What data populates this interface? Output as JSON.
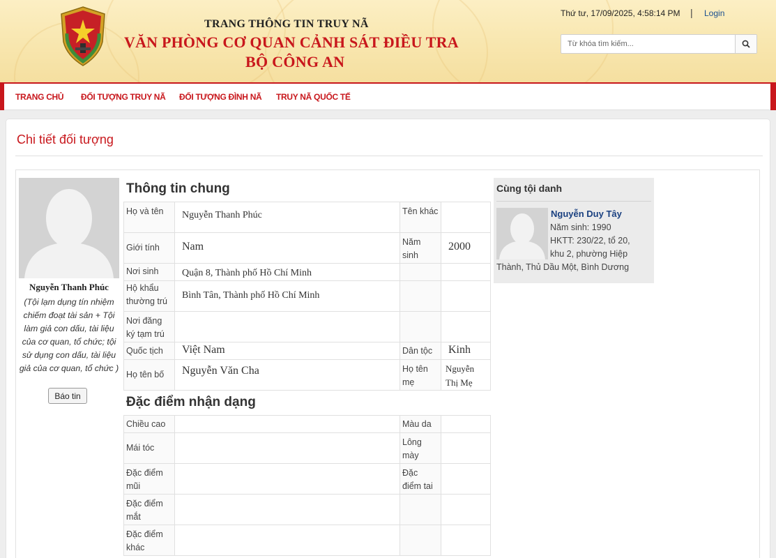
{
  "header": {
    "title_small": "TRANG THÔNG TIN TRUY NÃ",
    "title_main": "VĂN PHÒNG CƠ QUAN CẢNH SÁT ĐIỀU TRA",
    "title_sub": "BỘ CÔNG AN",
    "datetime": "Thứ tư, 17/09/2025, 4:58:14 PM",
    "separator": "|",
    "login_label": "Login",
    "search_placeholder": "Từ khóa tìm kiếm...",
    "search_icon": "search-icon",
    "emblem_icon": "police-emblem-icon"
  },
  "nav": {
    "items": [
      "TRANG CHỦ",
      "ĐỐI TƯỢNG TRUY NÃ",
      "ĐỐI TƯỢNG ĐÌNH NÃ",
      "TRUY NÃ QUỐC TẾ"
    ]
  },
  "page": {
    "title": "Chi tiết đối tượng"
  },
  "profile": {
    "name": "Nguyễn Thanh Phúc",
    "crime": "(Tội lạm dụng tín nhiệm chiếm đoạt tài sản + Tội làm giả con dấu, tài liệu của cơ quan, tổ chức; tội sử dụng con dấu, tài liệu giả của cơ quan, tổ chức )",
    "report_button": "Báo tin",
    "avatar_icon": "person-placeholder-icon"
  },
  "general": {
    "heading": "Thông tin chung",
    "full_name_label": "Họ và tên",
    "full_name": "Nguyễn Thanh Phúc",
    "other_name_label": "Tên khác",
    "other_name": "",
    "gender_label": "Giới tính",
    "gender": "Nam",
    "birth_year_label": "Năm sinh",
    "birth_year": "2000",
    "birthplace_label": "Nơi sinh",
    "birthplace": "Quận 8, Thành phố Hồ Chí Minh",
    "permanent_label": "Hộ khẩu thường trú",
    "permanent": "Bình Tân, Thành phố Hồ Chí Minh",
    "temporary_label": "Nơi đăng ký tạm trú",
    "temporary": "",
    "nationality_label": "Quốc tịch",
    "nationality": "Việt Nam",
    "ethnicity_label": "Dân tộc",
    "ethnicity": "Kinh",
    "father_label": "Họ tên bố",
    "father": "Nguyễn Văn Cha",
    "mother_label": "Họ tên mẹ",
    "mother": "Nguyễn Thị Mẹ"
  },
  "features": {
    "heading": "Đặc điểm nhận dạng",
    "height_label": "Chiều cao",
    "skin_label": "Màu da",
    "hair_label": "Mái tóc",
    "eyebrow_label": "Lông mày",
    "nose_label": "Đặc điểm mũi",
    "ear_label": "Đặc điểm tai",
    "eye_label": "Đặc điểm mắt",
    "other_label": "Đặc điểm khác"
  },
  "related": {
    "heading": "Cùng tội danh",
    "name": "Nguyễn Duy Tây",
    "birth": "Năm sinh: 1990",
    "address_part1": "HKTT: 230/22, tổ 20,",
    "address_part2": "khu 2, phường Hiệp",
    "address_part3": "Thành, Thủ Dầu Một, Bình Dương"
  }
}
